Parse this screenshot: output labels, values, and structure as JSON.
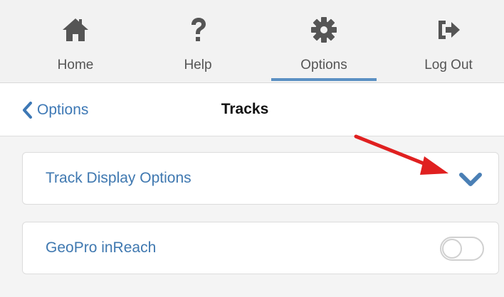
{
  "nav": {
    "items": [
      {
        "label": "Home",
        "icon": "home-icon"
      },
      {
        "label": "Help",
        "icon": "question-icon"
      },
      {
        "label": "Options",
        "icon": "gear-icon",
        "active": true
      },
      {
        "label": "Log Out",
        "icon": "logout-icon"
      }
    ]
  },
  "subheader": {
    "back_label": "Options",
    "title": "Tracks"
  },
  "settings": [
    {
      "label": "Track Display Options",
      "control": "chevron-down-icon"
    },
    {
      "label": "GeoPro inReach",
      "control": "toggle",
      "enabled": false
    }
  ],
  "colors": {
    "accent": "#3d78b5",
    "nav_icon": "#555555",
    "active_underline": "#5b90c3",
    "annotation": "#e02020"
  }
}
